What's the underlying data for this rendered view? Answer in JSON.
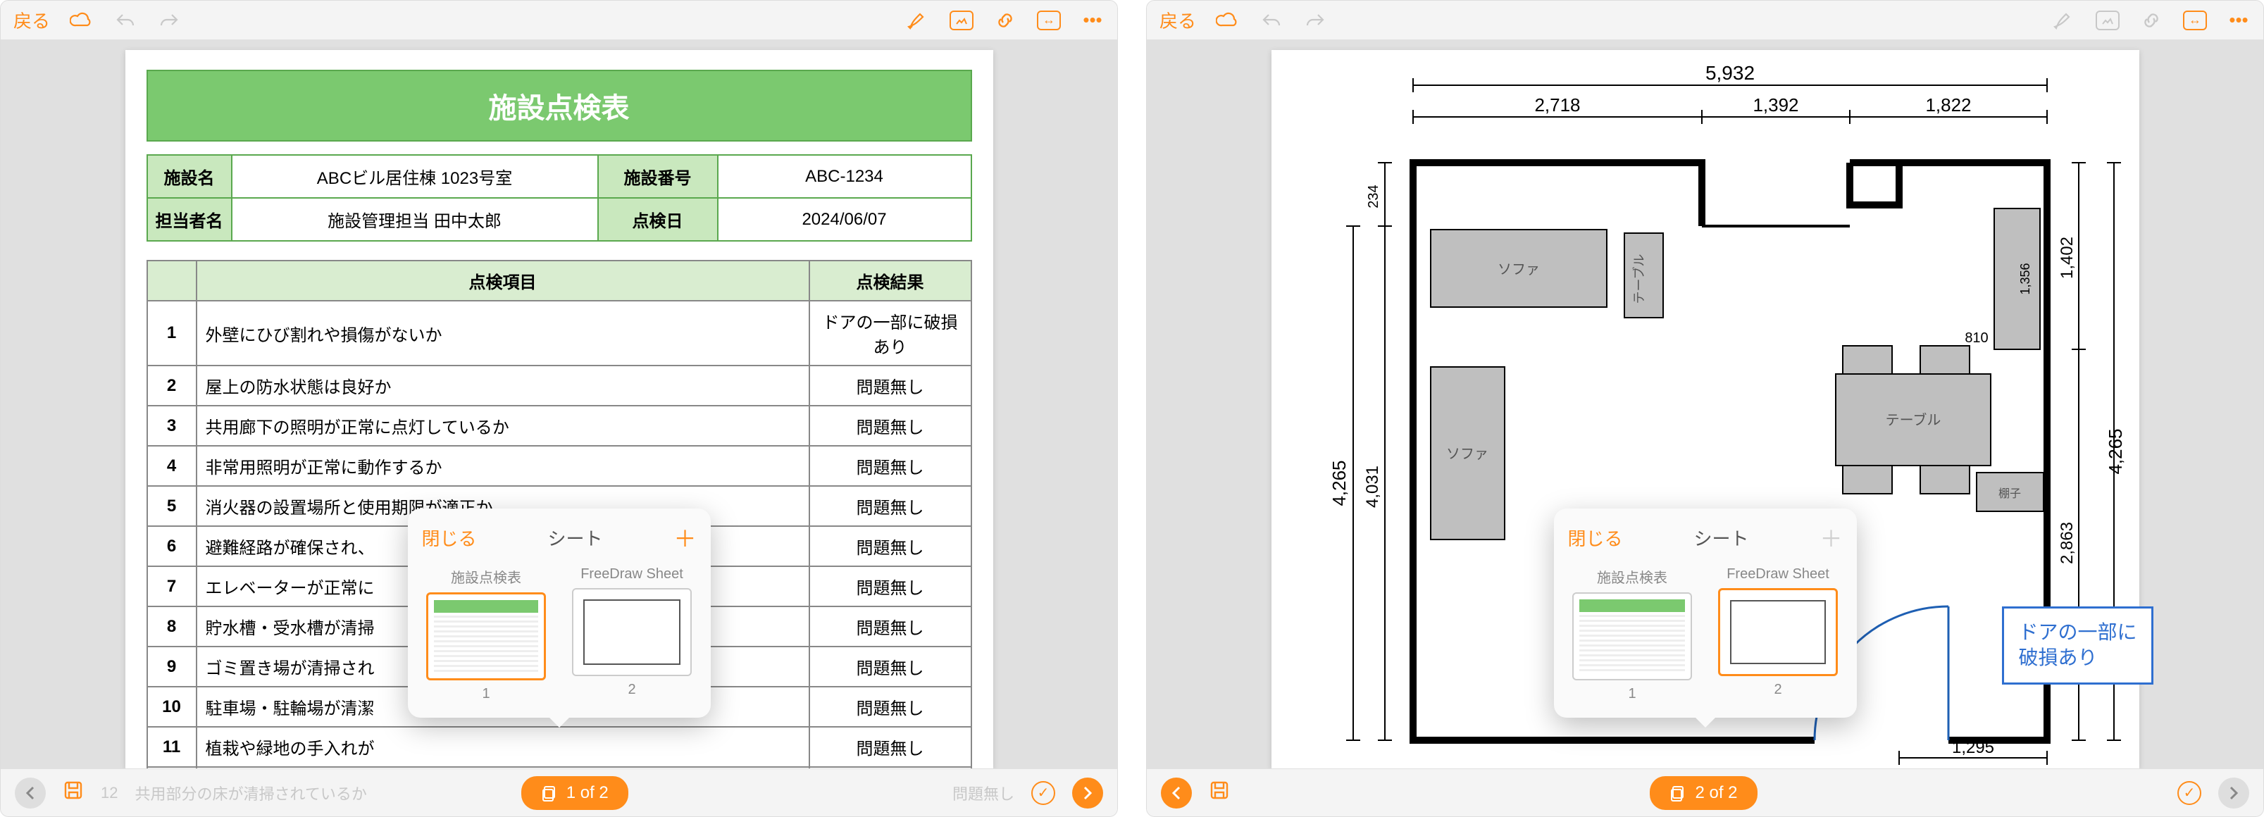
{
  "accent": "#ff8c1a",
  "left": {
    "toolbar": {
      "back": "戻る"
    },
    "doc": {
      "title": "施設点検表",
      "meta": {
        "name_label": "施設名",
        "name_value": "ABCビル居住棟 1023号室",
        "code_label": "施設番号",
        "code_value": "ABC-1234",
        "person_label": "担当者名",
        "person_value": "施設管理担当 田中太郎",
        "date_label": "点検日",
        "date_value": "2024/06/07"
      },
      "columns": {
        "item": "点検項目",
        "result": "点検結果"
      },
      "rows": [
        {
          "n": "1",
          "item": "外壁にひび割れや損傷がないか",
          "result": "ドアの一部に破損あり"
        },
        {
          "n": "2",
          "item": "屋上の防水状態は良好か",
          "result": "問題無し"
        },
        {
          "n": "3",
          "item": "共用廊下の照明が正常に点灯しているか",
          "result": "問題無し"
        },
        {
          "n": "4",
          "item": "非常用照明が正常に動作するか",
          "result": "問題無し"
        },
        {
          "n": "5",
          "item": "消火器の設置場所と使用期限が適正か",
          "result": "問題無し"
        },
        {
          "n": "6",
          "item": "避難経路が確保され、",
          "result": "問題無し"
        },
        {
          "n": "7",
          "item": "エレベーターが正常に",
          "result": "問題無し"
        },
        {
          "n": "8",
          "item": "貯水槽・受水槽が清掃",
          "result": "問題無し"
        },
        {
          "n": "9",
          "item": "ゴミ置き場が清掃され",
          "result": "問題無し"
        },
        {
          "n": "10",
          "item": "駐車場・駐輪場が清潔",
          "result": "問題無し"
        },
        {
          "n": "11",
          "item": "植栽や緑地の手入れが",
          "result": "問題無し"
        },
        {
          "n": "12",
          "item": "共用部分の床が清掃されているか",
          "result": "問題無し"
        }
      ]
    },
    "popover": {
      "close": "閉じる",
      "title": "シート",
      "add_enabled": true,
      "sheets": [
        {
          "name": "施設点検表",
          "num": "1",
          "kind": "check",
          "active": true,
          "trash": true
        },
        {
          "name": "FreeDraw Sheet",
          "num": "2",
          "kind": "plan",
          "active": false,
          "trash": false
        }
      ]
    },
    "bottom": {
      "faint_num": "12",
      "indicator": "1 of 2"
    }
  },
  "right": {
    "toolbar": {
      "back": "戻る"
    },
    "floorplan": {
      "dims": {
        "total_w": "5,932",
        "w1": "2,718",
        "w2": "1,392",
        "w3": "1,822",
        "h_total": "4,265",
        "h_inner": "4,031",
        "h_r1": "1,402",
        "h_r2": "2,863",
        "small_h": "234",
        "shelf": "1,356",
        "gap": "810",
        "bottom": "1,295"
      },
      "labels": {
        "sofa": "ソファ",
        "table": "テーブル",
        "shelf": "棚子"
      },
      "callout": "ドアの一部に\n破損あり"
    },
    "popover": {
      "close": "閉じる",
      "title": "シート",
      "add_enabled": false,
      "sheets": [
        {
          "name": "施設点検表",
          "num": "1",
          "kind": "check",
          "active": false,
          "trash": true
        },
        {
          "name": "FreeDraw Sheet",
          "num": "2",
          "kind": "plan",
          "active": true,
          "trash": false
        }
      ]
    },
    "bottom": {
      "indicator": "2 of 2"
    }
  }
}
